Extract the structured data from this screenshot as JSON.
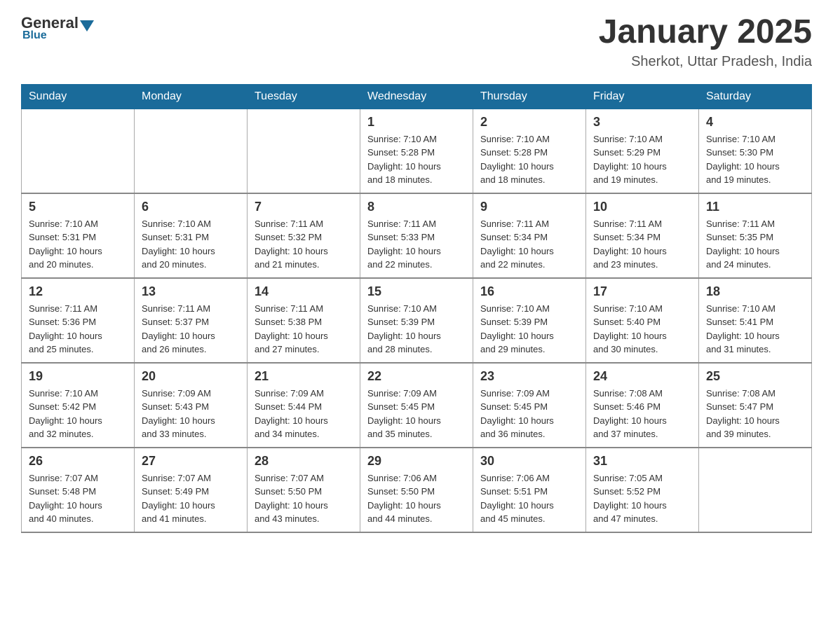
{
  "header": {
    "logo": {
      "general": "General",
      "blue": "Blue",
      "subtitle": "Blue"
    },
    "title": "January 2025",
    "location": "Sherkot, Uttar Pradesh, India"
  },
  "calendar": {
    "days": [
      "Sunday",
      "Monday",
      "Tuesday",
      "Wednesday",
      "Thursday",
      "Friday",
      "Saturday"
    ],
    "weeks": [
      [
        {
          "day": "",
          "info": ""
        },
        {
          "day": "",
          "info": ""
        },
        {
          "day": "",
          "info": ""
        },
        {
          "day": "1",
          "info": "Sunrise: 7:10 AM\nSunset: 5:28 PM\nDaylight: 10 hours\nand 18 minutes."
        },
        {
          "day": "2",
          "info": "Sunrise: 7:10 AM\nSunset: 5:28 PM\nDaylight: 10 hours\nand 18 minutes."
        },
        {
          "day": "3",
          "info": "Sunrise: 7:10 AM\nSunset: 5:29 PM\nDaylight: 10 hours\nand 19 minutes."
        },
        {
          "day": "4",
          "info": "Sunrise: 7:10 AM\nSunset: 5:30 PM\nDaylight: 10 hours\nand 19 minutes."
        }
      ],
      [
        {
          "day": "5",
          "info": "Sunrise: 7:10 AM\nSunset: 5:31 PM\nDaylight: 10 hours\nand 20 minutes."
        },
        {
          "day": "6",
          "info": "Sunrise: 7:10 AM\nSunset: 5:31 PM\nDaylight: 10 hours\nand 20 minutes."
        },
        {
          "day": "7",
          "info": "Sunrise: 7:11 AM\nSunset: 5:32 PM\nDaylight: 10 hours\nand 21 minutes."
        },
        {
          "day": "8",
          "info": "Sunrise: 7:11 AM\nSunset: 5:33 PM\nDaylight: 10 hours\nand 22 minutes."
        },
        {
          "day": "9",
          "info": "Sunrise: 7:11 AM\nSunset: 5:34 PM\nDaylight: 10 hours\nand 22 minutes."
        },
        {
          "day": "10",
          "info": "Sunrise: 7:11 AM\nSunset: 5:34 PM\nDaylight: 10 hours\nand 23 minutes."
        },
        {
          "day": "11",
          "info": "Sunrise: 7:11 AM\nSunset: 5:35 PM\nDaylight: 10 hours\nand 24 minutes."
        }
      ],
      [
        {
          "day": "12",
          "info": "Sunrise: 7:11 AM\nSunset: 5:36 PM\nDaylight: 10 hours\nand 25 minutes."
        },
        {
          "day": "13",
          "info": "Sunrise: 7:11 AM\nSunset: 5:37 PM\nDaylight: 10 hours\nand 26 minutes."
        },
        {
          "day": "14",
          "info": "Sunrise: 7:11 AM\nSunset: 5:38 PM\nDaylight: 10 hours\nand 27 minutes."
        },
        {
          "day": "15",
          "info": "Sunrise: 7:10 AM\nSunset: 5:39 PM\nDaylight: 10 hours\nand 28 minutes."
        },
        {
          "day": "16",
          "info": "Sunrise: 7:10 AM\nSunset: 5:39 PM\nDaylight: 10 hours\nand 29 minutes."
        },
        {
          "day": "17",
          "info": "Sunrise: 7:10 AM\nSunset: 5:40 PM\nDaylight: 10 hours\nand 30 minutes."
        },
        {
          "day": "18",
          "info": "Sunrise: 7:10 AM\nSunset: 5:41 PM\nDaylight: 10 hours\nand 31 minutes."
        }
      ],
      [
        {
          "day": "19",
          "info": "Sunrise: 7:10 AM\nSunset: 5:42 PM\nDaylight: 10 hours\nand 32 minutes."
        },
        {
          "day": "20",
          "info": "Sunrise: 7:09 AM\nSunset: 5:43 PM\nDaylight: 10 hours\nand 33 minutes."
        },
        {
          "day": "21",
          "info": "Sunrise: 7:09 AM\nSunset: 5:44 PM\nDaylight: 10 hours\nand 34 minutes."
        },
        {
          "day": "22",
          "info": "Sunrise: 7:09 AM\nSunset: 5:45 PM\nDaylight: 10 hours\nand 35 minutes."
        },
        {
          "day": "23",
          "info": "Sunrise: 7:09 AM\nSunset: 5:45 PM\nDaylight: 10 hours\nand 36 minutes."
        },
        {
          "day": "24",
          "info": "Sunrise: 7:08 AM\nSunset: 5:46 PM\nDaylight: 10 hours\nand 37 minutes."
        },
        {
          "day": "25",
          "info": "Sunrise: 7:08 AM\nSunset: 5:47 PM\nDaylight: 10 hours\nand 39 minutes."
        }
      ],
      [
        {
          "day": "26",
          "info": "Sunrise: 7:07 AM\nSunset: 5:48 PM\nDaylight: 10 hours\nand 40 minutes."
        },
        {
          "day": "27",
          "info": "Sunrise: 7:07 AM\nSunset: 5:49 PM\nDaylight: 10 hours\nand 41 minutes."
        },
        {
          "day": "28",
          "info": "Sunrise: 7:07 AM\nSunset: 5:50 PM\nDaylight: 10 hours\nand 43 minutes."
        },
        {
          "day": "29",
          "info": "Sunrise: 7:06 AM\nSunset: 5:50 PM\nDaylight: 10 hours\nand 44 minutes."
        },
        {
          "day": "30",
          "info": "Sunrise: 7:06 AM\nSunset: 5:51 PM\nDaylight: 10 hours\nand 45 minutes."
        },
        {
          "day": "31",
          "info": "Sunrise: 7:05 AM\nSunset: 5:52 PM\nDaylight: 10 hours\nand 47 minutes."
        },
        {
          "day": "",
          "info": ""
        }
      ]
    ]
  }
}
